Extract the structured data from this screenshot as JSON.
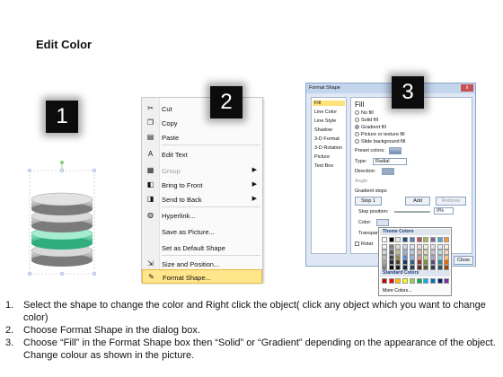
{
  "title": "Edit Color",
  "badges": [
    "1",
    "2",
    "3"
  ],
  "context_menu": {
    "items": [
      {
        "label": "Cut",
        "icon": "scissors-icon",
        "glyph": "✂",
        "disabled": false,
        "submenu": false
      },
      {
        "label": "Copy",
        "icon": "copy-icon",
        "glyph": "❐",
        "disabled": false,
        "submenu": false
      },
      {
        "label": "Paste",
        "icon": "paste-icon",
        "glyph": "▤",
        "disabled": false,
        "submenu": false
      },
      {
        "label": "Edit Text",
        "icon": "edit-text-icon",
        "glyph": "A",
        "disabled": false,
        "submenu": false
      },
      {
        "label": "Group",
        "icon": "group-icon",
        "glyph": "▦",
        "disabled": true,
        "submenu": true
      },
      {
        "label": "Bring to Front",
        "icon": "bring-to-front-icon",
        "glyph": "◧",
        "disabled": false,
        "submenu": true
      },
      {
        "label": "Send to Back",
        "icon": "send-to-back-icon",
        "glyph": "◨",
        "disabled": false,
        "submenu": true
      },
      {
        "label": "Hyperlink...",
        "icon": "hyperlink-icon",
        "glyph": "◍",
        "disabled": false,
        "submenu": false
      },
      {
        "label": "Save as Picture...",
        "icon": "",
        "glyph": "",
        "disabled": false,
        "submenu": false
      },
      {
        "label": "Set as Default Shape",
        "icon": "",
        "glyph": "",
        "disabled": false,
        "submenu": false
      },
      {
        "label": "Size and Position...",
        "icon": "size-position-icon",
        "glyph": "⇲",
        "disabled": false,
        "submenu": false
      },
      {
        "label": "Format Shape...",
        "icon": "format-shape-icon",
        "glyph": "✎",
        "disabled": false,
        "submenu": false,
        "highlighted": true
      }
    ]
  },
  "dialog": {
    "title": "Format Shape",
    "close": "x",
    "categories": [
      "Fill",
      "Line Color",
      "Line Style",
      "Shadow",
      "3-D Format",
      "3-D Rotation",
      "Picture",
      "Text Box"
    ],
    "heading": "Fill",
    "fill_options": [
      "No fill",
      "Solid fill",
      "Gradient fill",
      "Picture or texture fill",
      "Slide background fill"
    ],
    "selected_fill": "Gradient fill",
    "preset_label": "Preset colors:",
    "type_label": "Type:",
    "type_value": "Radial",
    "direction_label": "Direction:",
    "angle_label": "Angle:",
    "angle_value": "0°",
    "gradient_stops_label": "Gradient stops",
    "stop_select": "Stop 1",
    "add_button": "Add",
    "remove_button": "Remove",
    "stop_position_label": "Stop position:",
    "stop_position_value": "0%",
    "color_label": "Color:",
    "transparency_label": "Transpar",
    "rotate_label": "Rotat",
    "close_button": "Close"
  },
  "picker": {
    "theme_label": "Theme Colors",
    "standard_label": "Standard Colors",
    "more_label": "More Colors...",
    "theme_row1": [
      "#ffffff",
      "#000000",
      "#eeece1",
      "#1f497d",
      "#4f81bd",
      "#c0504d",
      "#9bbb59",
      "#8064a2",
      "#4bacc6",
      "#f79646"
    ],
    "theme_shades": [
      [
        "#f2f2f2",
        "#7f7f7f",
        "#ddd9c3",
        "#c6d9f0",
        "#dbe5f1",
        "#f2dcdb",
        "#ebf1dd",
        "#e5e0ec",
        "#dbeef3",
        "#fdeada"
      ],
      [
        "#d8d8d8",
        "#595959",
        "#c4bd97",
        "#8db3e2",
        "#b8cce4",
        "#e5b9b7",
        "#d7e3bc",
        "#ccc1d9",
        "#b7dde8",
        "#fbd5b5"
      ],
      [
        "#bfbfbf",
        "#3f3f3f",
        "#938953",
        "#548dd4",
        "#95b3d7",
        "#d99694",
        "#c3d69b",
        "#b2a2c7",
        "#92cddc",
        "#fac08f"
      ],
      [
        "#a5a5a5",
        "#262626",
        "#494429",
        "#17365d",
        "#366092",
        "#953734",
        "#76923c",
        "#5f497a",
        "#31859b",
        "#e36c09"
      ],
      [
        "#7f7f7f",
        "#0c0c0c",
        "#1d1b10",
        "#0f243e",
        "#244061",
        "#632423",
        "#4f6128",
        "#3f3151",
        "#205867",
        "#974806"
      ]
    ],
    "standard": [
      "#c00000",
      "#ff0000",
      "#ffc000",
      "#ffff00",
      "#92d050",
      "#00b050",
      "#00b0f0",
      "#0070c0",
      "#002060",
      "#7030a0"
    ]
  },
  "instructions": [
    {
      "num": "1.",
      "text": "Select the shape to change the color and Right click the object( click any object which you want to change color)"
    },
    {
      "num": "2.",
      "text": "Choose Format Shape in the dialog box."
    },
    {
      "num": "3.",
      "text": "Choose “Fill” in the Format Shape box then “Solid” or “Gradient” depending on the appearance of the object. Change colour as shown in the picture."
    }
  ]
}
